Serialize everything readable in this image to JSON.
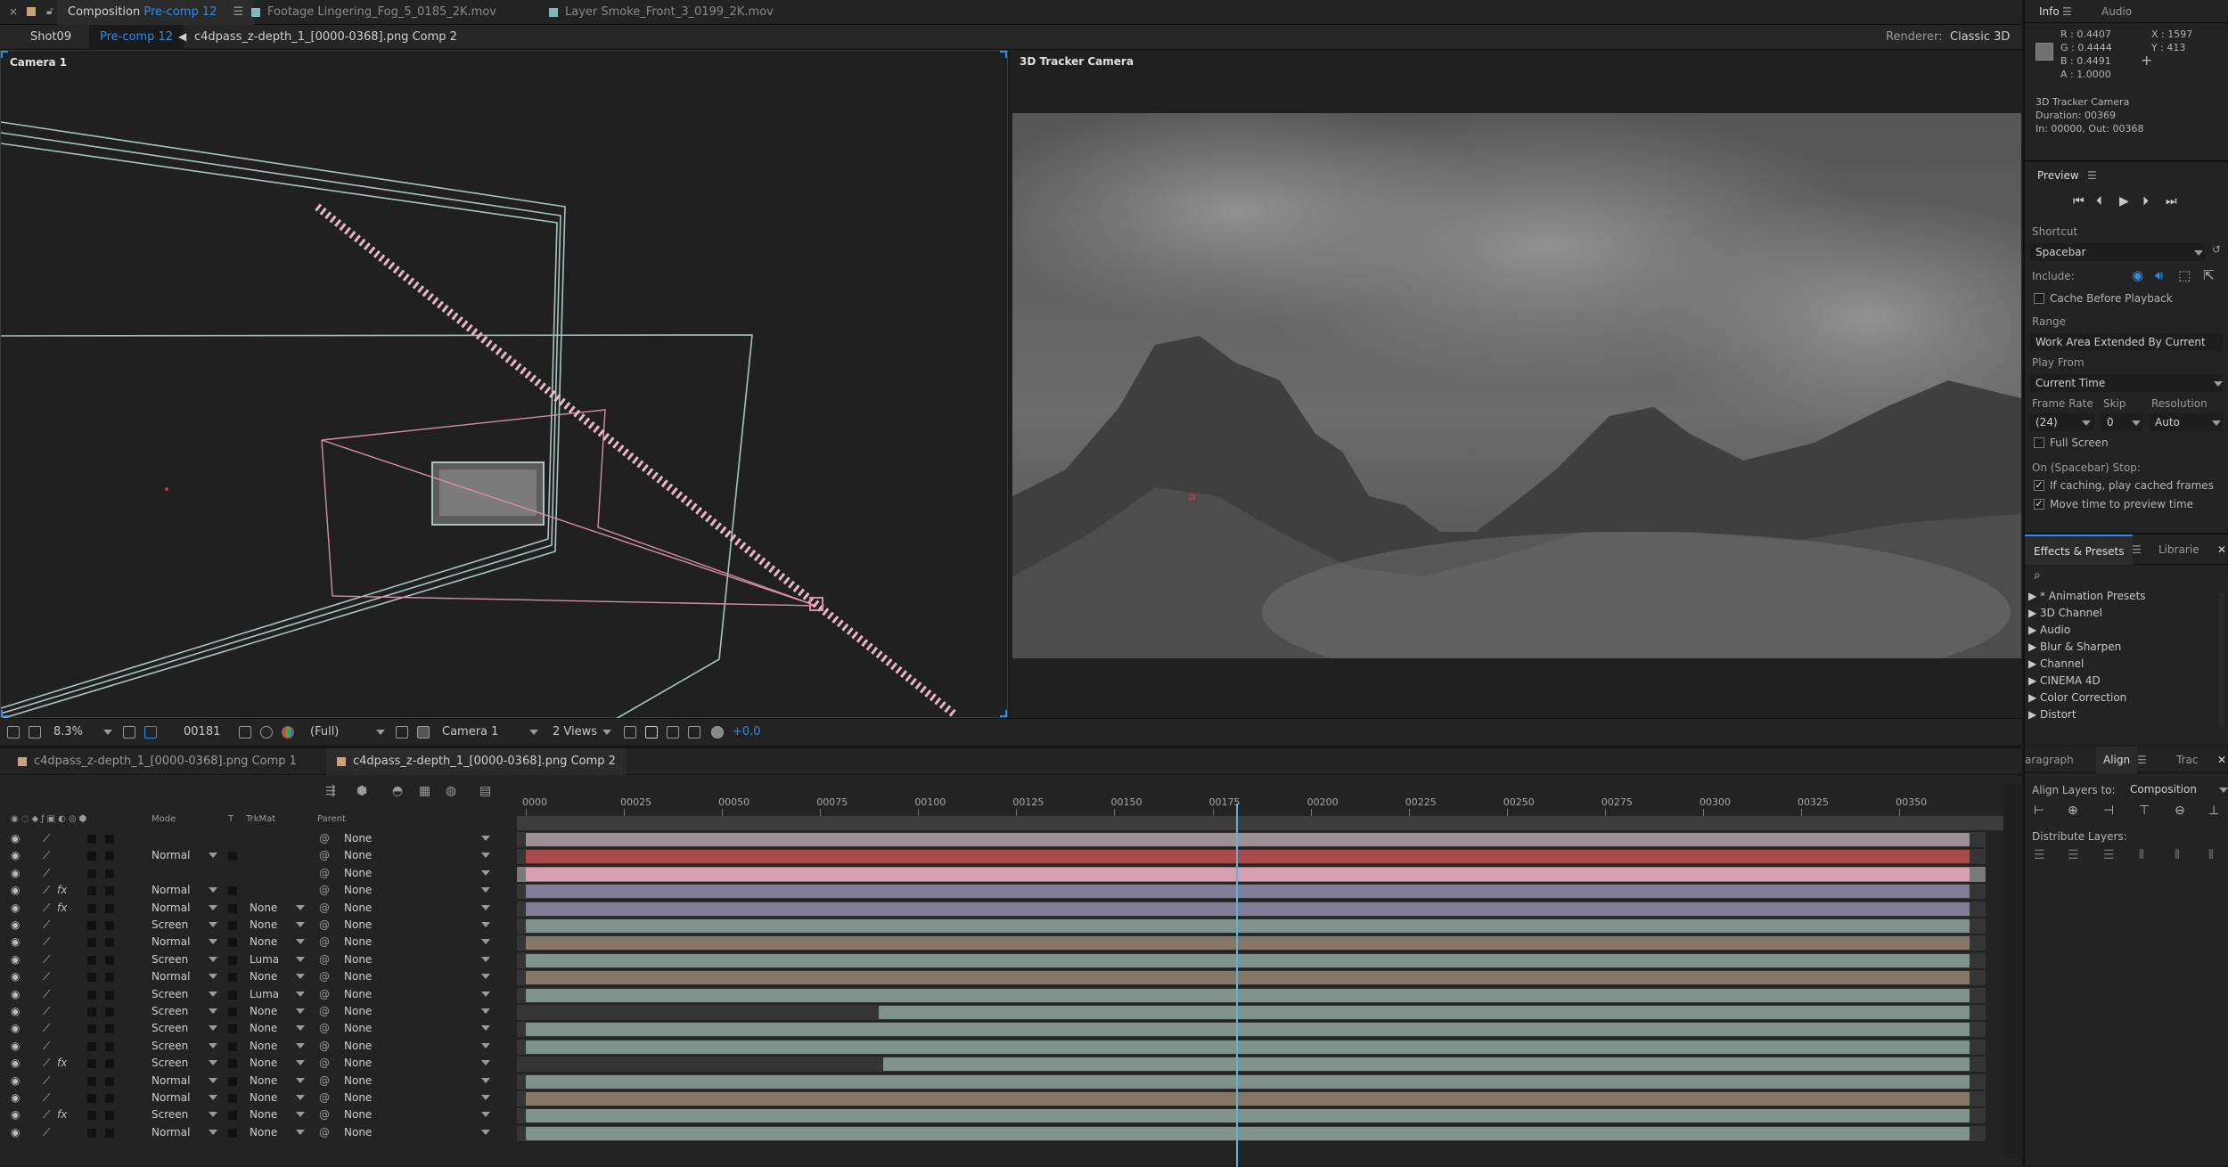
{
  "top_tabs": [
    {
      "label": "Composition",
      "tag": "Pre-comp 12",
      "active": true,
      "swatch": "#c8a27a"
    },
    {
      "label": "Footage Lingering_Fog_5_0185_2K.mov",
      "active": false,
      "swatch": "#7fb8b8"
    },
    {
      "label": "Layer Smoke_Front_3_0199_2K.mov",
      "active": false,
      "swatch": "#7fb8b8"
    }
  ],
  "comp_nav": {
    "items": [
      "Shot09",
      "Pre-comp 12",
      "c4dpass_z-depth_1_[0000-0368].png Comp 2"
    ],
    "renderer_label": "Renderer:",
    "renderer_value": "Classic 3D"
  },
  "viewer_left": {
    "label": "Camera 1"
  },
  "viewer_right": {
    "label": "3D Tracker Camera"
  },
  "viewer_bar": {
    "zoom": "8.3%",
    "timecode": "00181",
    "resolution": "(Full)",
    "camera": "Camera 1",
    "views": "2 Views",
    "exposure": "+0.0"
  },
  "info_panel": {
    "tabs": [
      "Info",
      "Audio"
    ],
    "r": "R : 0.4407",
    "g": "G : 0.4444",
    "b": "B : 0.4491",
    "a": "A : 1.0000",
    "x": "X : 1597",
    "y": "Y : 413",
    "lines": [
      "3D Tracker Camera",
      "Duration: 00369",
      "In: 00000, Out: 00368"
    ],
    "swatch": "#707173"
  },
  "preview_panel": {
    "title": "Preview",
    "shortcut_label": "Shortcut",
    "shortcut": "Spacebar",
    "include_label": "Include:",
    "cache_before": "Cache Before Playback",
    "range_label": "Range",
    "range": "Work Area Extended By Current Tim",
    "play_from_label": "Play From",
    "play_from": "Current Time",
    "frame_rate_label": "Frame Rate",
    "skip_label": "Skip",
    "resolution_label": "Resolution",
    "frame_rate": "(24)",
    "skip": "0",
    "resolution": "Auto",
    "full_screen": "Full Screen",
    "stop_label": "On (Spacebar) Stop:",
    "opt1": "If caching, play cached frames",
    "opt2": "Move time to preview time"
  },
  "effects_panel": {
    "tabs": [
      "Effects & Presets",
      "Librarie"
    ],
    "items": [
      "* Animation Presets",
      "3D Channel",
      "Audio",
      "Blur & Sharpen",
      "Channel",
      "CINEMA 4D",
      "Color Correction",
      "Distort"
    ]
  },
  "timeline_tabs": [
    {
      "label": "c4dpass_z-depth_1_[0000-0368].png Comp 1",
      "active": false
    },
    {
      "label": "c4dpass_z-depth_1_[0000-0368].png Comp 2",
      "active": true
    }
  ],
  "columns": {
    "mode": "Mode",
    "t": "T",
    "trkmat": "TrkMat",
    "parent": "Parent"
  },
  "ruler": {
    "labels": [
      "0000",
      "00025",
      "00050",
      "00075",
      "00100",
      "00125",
      "00150",
      "00175",
      "00200",
      "00225",
      "00250",
      "00275",
      "00300",
      "00325",
      "00350"
    ],
    "start": 0,
    "end": 372,
    "current": 181
  },
  "layers": [
    {
      "mode": "",
      "trkmat": "",
      "parent": "None",
      "fx": false,
      "color": "#9e8f96",
      "start": 0,
      "track": "#353535"
    },
    {
      "mode": "Normal",
      "trkmat": "",
      "parent": "None",
      "fx": false,
      "color": "#a94b4d",
      "start": 0,
      "track": "#353535"
    },
    {
      "mode": "",
      "trkmat": "",
      "parent": "None",
      "fx": false,
      "color": "#d7a1b3",
      "start": 0,
      "track": "#7a7a7a"
    },
    {
      "mode": "Normal",
      "trkmat": "",
      "parent": "None",
      "fx": true,
      "color": "#7f7d97",
      "start": 0,
      "track": "#353535"
    },
    {
      "mode": "Normal",
      "trkmat": "None",
      "parent": "None",
      "fx": true,
      "color": "#7f7d97",
      "start": 0,
      "track": "#353535"
    },
    {
      "mode": "Screen",
      "trkmat": "None",
      "parent": "None",
      "fx": false,
      "color": "#7f928c",
      "start": 0,
      "track": "#353535"
    },
    {
      "mode": "Normal",
      "trkmat": "None",
      "parent": "None",
      "fx": false,
      "color": "#857766",
      "start": 0,
      "track": "#353535"
    },
    {
      "mode": "Screen",
      "trkmat": "Luma",
      "parent": "None",
      "fx": false,
      "color": "#7f928c",
      "start": 0,
      "track": "#353535"
    },
    {
      "mode": "Normal",
      "trkmat": "None",
      "parent": "None",
      "fx": false,
      "color": "#857766",
      "start": 0,
      "track": "#353535"
    },
    {
      "mode": "Screen",
      "trkmat": "Luma",
      "parent": "None",
      "fx": false,
      "color": "#7f928c",
      "start": 0,
      "track": "#353535"
    },
    {
      "mode": "Screen",
      "trkmat": "None",
      "parent": "None",
      "fx": false,
      "color": "#7f928c",
      "start": 90,
      "track": "#353535"
    },
    {
      "mode": "Screen",
      "trkmat": "None",
      "parent": "None",
      "fx": false,
      "color": "#7f928c",
      "start": 0,
      "track": "#353535"
    },
    {
      "mode": "Screen",
      "trkmat": "None",
      "parent": "None",
      "fx": false,
      "color": "#7f928c",
      "start": 0,
      "track": "#353535"
    },
    {
      "mode": "Screen",
      "trkmat": "None",
      "parent": "None",
      "fx": true,
      "color": "#7f928c",
      "start": 91,
      "track": "#353535"
    },
    {
      "mode": "Normal",
      "trkmat": "None",
      "parent": "None",
      "fx": false,
      "color": "#7f928c",
      "start": 0,
      "track": "#353535"
    },
    {
      "mode": "Normal",
      "trkmat": "None",
      "parent": "None",
      "fx": false,
      "color": "#857766",
      "start": 0,
      "track": "#353535"
    },
    {
      "mode": "Screen",
      "trkmat": "None",
      "parent": "None",
      "fx": true,
      "color": "#7f928c",
      "start": 0,
      "track": "#353535"
    },
    {
      "mode": "Normal",
      "trkmat": "None",
      "parent": "None",
      "fx": false,
      "color": "#7f928c",
      "start": 0,
      "track": "#353535"
    }
  ],
  "align_panel": {
    "tabs": [
      "aragraph",
      "Align",
      "Trac"
    ],
    "align_to_label": "Align Layers to:",
    "align_to": "Composition",
    "distribute_label": "Distribute Layers:"
  },
  "colors": {
    "accent": "#2d8ceb",
    "playhead": "#4fb5e6"
  }
}
